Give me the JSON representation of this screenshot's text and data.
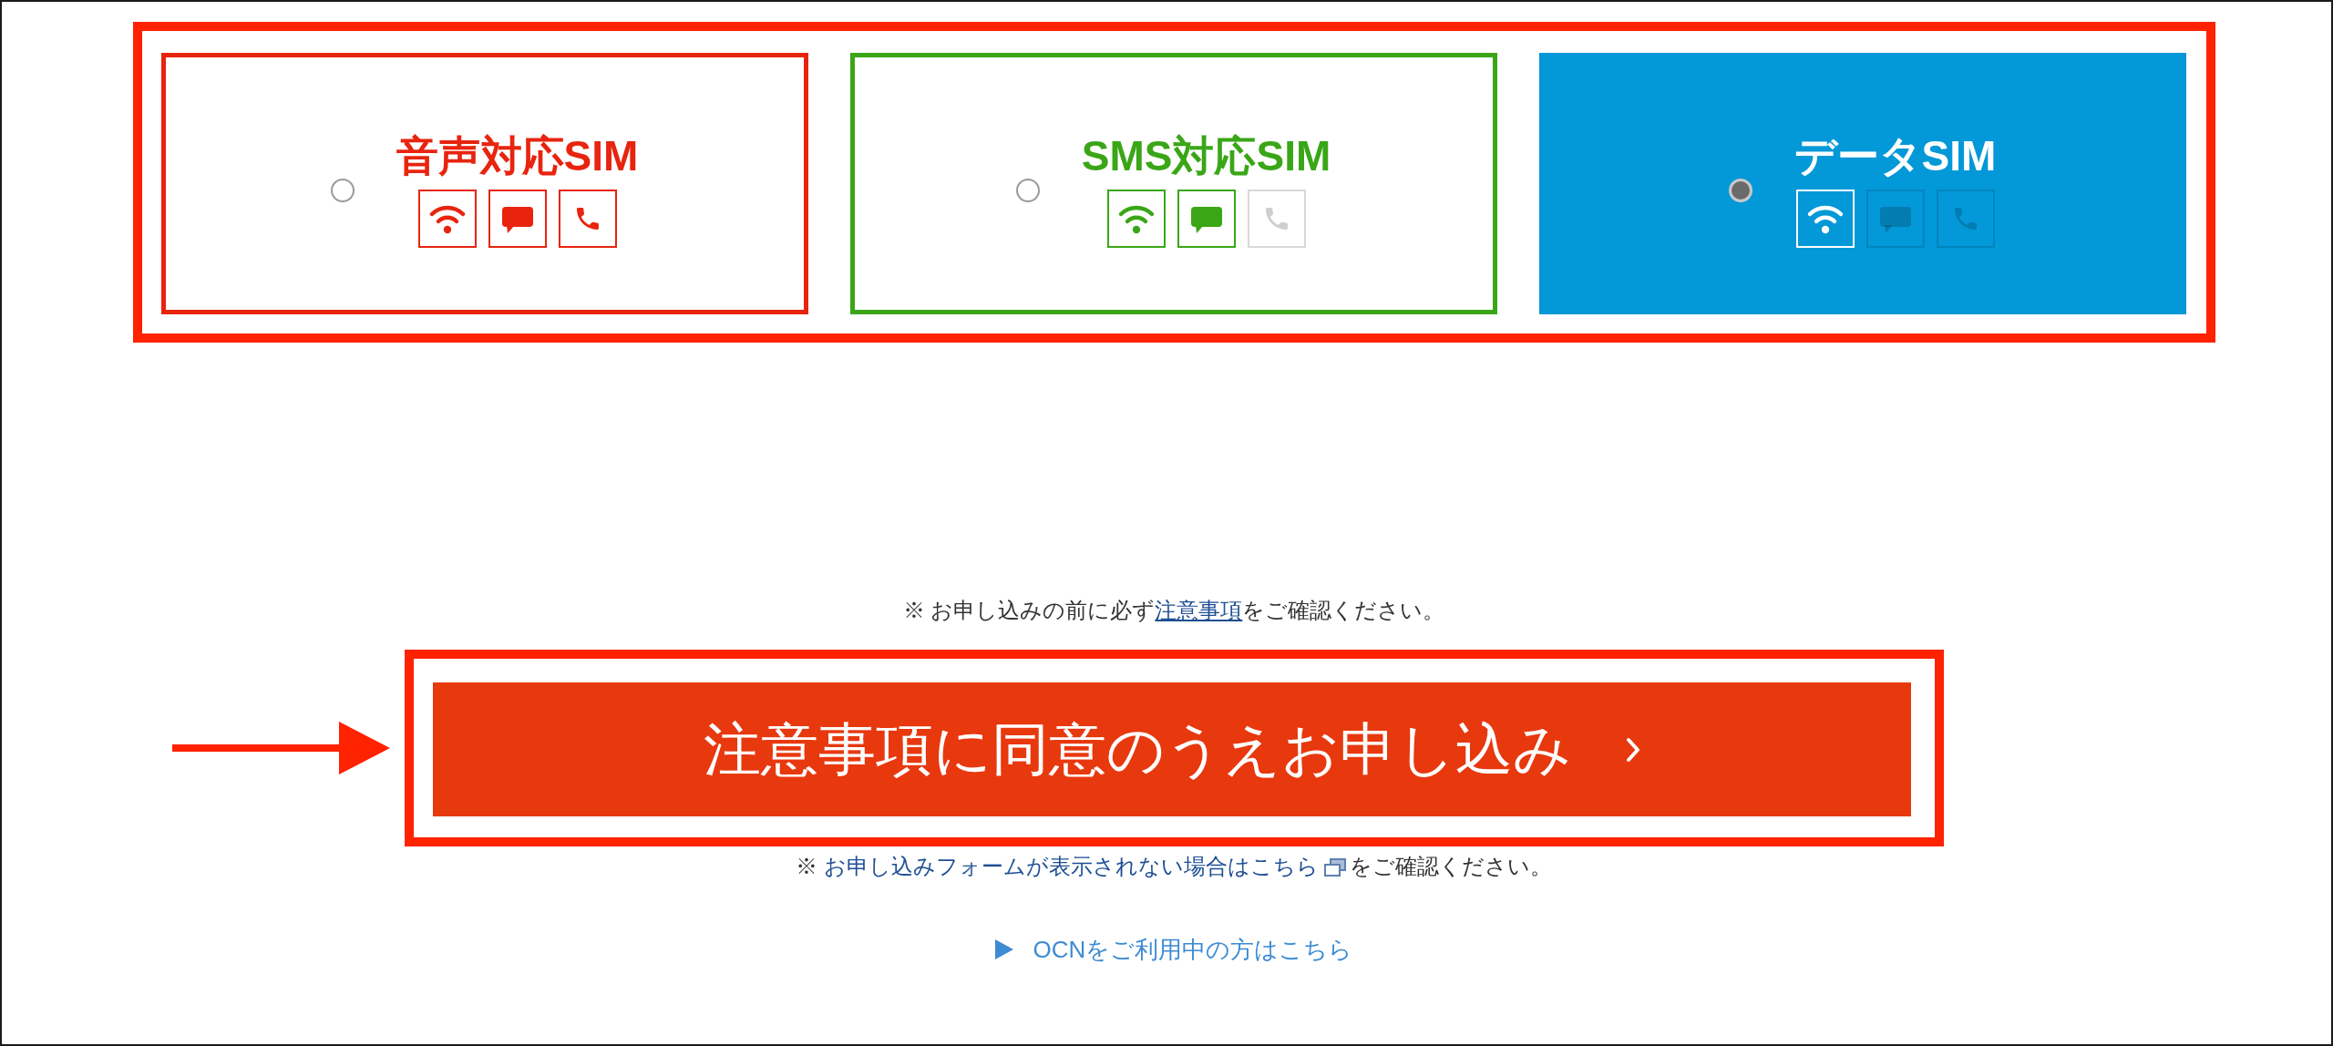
{
  "plans": [
    {
      "title": "音声対応SIM",
      "color": "#e8240f",
      "selected": false,
      "features": [
        {
          "kind": "wifi",
          "enabled": true
        },
        {
          "kind": "sms",
          "enabled": true
        },
        {
          "kind": "phone",
          "enabled": true
        }
      ]
    },
    {
      "title": "SMS対応SIM",
      "color": "#3aa617",
      "selected": false,
      "features": [
        {
          "kind": "wifi",
          "enabled": true
        },
        {
          "kind": "sms",
          "enabled": true
        },
        {
          "kind": "phone",
          "enabled": false
        }
      ]
    },
    {
      "title": "データSIM",
      "color": "#0398d8",
      "selected": true,
      "features": [
        {
          "kind": "wifi",
          "enabled": true
        },
        {
          "kind": "sms",
          "enabled": false
        },
        {
          "kind": "phone",
          "enabled": false
        }
      ]
    }
  ],
  "notice": {
    "prefix": "※ お申し込みの前に必ず",
    "link": "注意事項",
    "suffix": "をご確認ください。"
  },
  "apply_button": {
    "label": "注意事項に同意のうえお申し込み"
  },
  "form_notice": {
    "prefix": "※ ",
    "link": "お申し込みフォームが表示されない場合はこちら",
    "suffix": "をご確認ください。"
  },
  "ocn_link": {
    "label": "OCNをご利用中の方はこちら"
  }
}
